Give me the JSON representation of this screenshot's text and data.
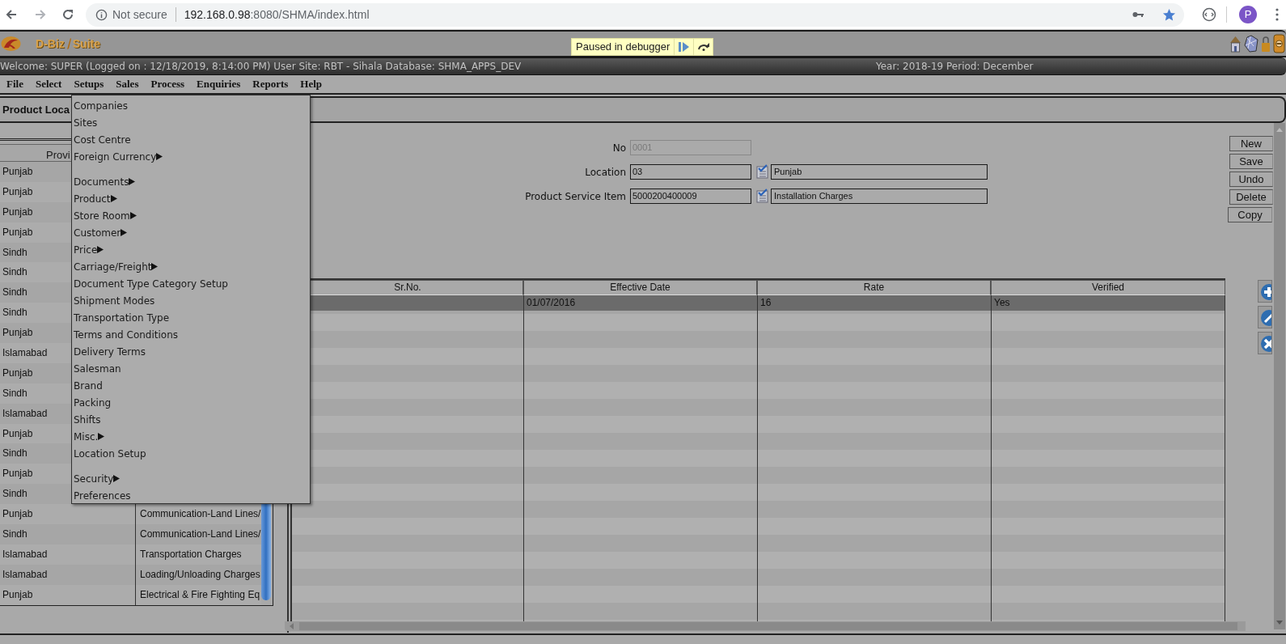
{
  "browser": {
    "security_label": "Not secure",
    "url_host": "192.168.0.98",
    "url_rest": ":8080/SHMA/index.html",
    "profile_initial": "P"
  },
  "app_header": {
    "logo_text_1": "D-Biz",
    "logo_text_2": "Suite"
  },
  "debugger_banner": {
    "label": "Paused in debugger"
  },
  "status_bar": {
    "welcome": "Welcome: SUPER (Logged on : 12/18/2019, 8:14:00 PM) User Site: RBT - Sihala Database: SHMA_APPS_DEV",
    "period": "Year: 2018-19 Period: December"
  },
  "menu_bar": [
    "File",
    "Select",
    "Setups",
    "Sales",
    "Process",
    "Enquiries",
    "Reports",
    "Help"
  ],
  "open_menu": {
    "groups": [
      [
        {
          "label": "Companies",
          "submenu": false
        },
        {
          "label": "Sites",
          "submenu": false
        },
        {
          "label": "Cost Centre",
          "submenu": false
        },
        {
          "label": "Foreign Currency",
          "submenu": true
        }
      ],
      [
        {
          "label": "Documents",
          "submenu": true
        },
        {
          "label": "Product",
          "submenu": true
        },
        {
          "label": "Store Room",
          "submenu": true
        },
        {
          "label": "Customer",
          "submenu": true
        },
        {
          "label": "Price",
          "submenu": true
        },
        {
          "label": "Carriage/Freight",
          "submenu": true
        },
        {
          "label": "Document Type Category Setup",
          "submenu": false
        },
        {
          "label": "Shipment Modes",
          "submenu": false
        },
        {
          "label": "Transportation Type",
          "submenu": false
        },
        {
          "label": "Terms and Conditions",
          "submenu": false
        },
        {
          "label": "Delivery Terms",
          "submenu": false
        },
        {
          "label": "Salesman",
          "submenu": false
        },
        {
          "label": "Brand",
          "submenu": false
        },
        {
          "label": "Packing",
          "submenu": false
        },
        {
          "label": "Shifts",
          "submenu": false
        },
        {
          "label": "Misc.",
          "submenu": true
        },
        {
          "label": "Location Setup",
          "submenu": false
        }
      ],
      [
        {
          "label": "Security",
          "submenu": true
        },
        {
          "label": "Preferences",
          "submenu": false
        }
      ]
    ]
  },
  "page_title": "Product Loca",
  "left_table": {
    "column_1": "Provi",
    "rows": [
      {
        "province": "Punjab"
      },
      {
        "province": "Punjab"
      },
      {
        "province": "Punjab"
      },
      {
        "province": "Punjab"
      },
      {
        "province": "Sindh"
      },
      {
        "province": "Sindh"
      },
      {
        "province": "Sindh"
      },
      {
        "province": "Sindh"
      },
      {
        "province": "Punjab"
      },
      {
        "province": "Islamabad"
      },
      {
        "province": "Punjab"
      },
      {
        "province": "Sindh"
      },
      {
        "province": "Islamabad"
      },
      {
        "province": "Punjab"
      },
      {
        "province": "Sindh"
      },
      {
        "province": "Punjab"
      },
      {
        "province": "Sindh"
      },
      {
        "province": "Punjab",
        "item": "Communication-Land Lines/"
      },
      {
        "province": "Sindh",
        "item": "Communication-Land Lines/"
      },
      {
        "province": "Islamabad",
        "item": "Transportation Charges"
      },
      {
        "province": "Islamabad",
        "item": "Loading/Unloading Charges"
      },
      {
        "province": "Punjab",
        "item": "Electrical & Fire Fighting Eq"
      }
    ]
  },
  "form": {
    "fields": [
      {
        "label": "No",
        "value": "0001",
        "disabled": true
      },
      {
        "label": "Location",
        "value": "03",
        "lookup": "Punjab",
        "disabled": false
      },
      {
        "label": "Product Service Item",
        "value": "5000200400009",
        "lookup": "Installation Charges",
        "disabled": false
      }
    ]
  },
  "actions": [
    "New",
    "Save",
    "Undo",
    "Delete",
    "Copy"
  ],
  "grid": {
    "columns": [
      "Sr.No.",
      "Effective Date",
      "Rate",
      "Verified"
    ],
    "rows": [
      {
        "effective_date": "01/07/2016",
        "rate": "16",
        "verified": "Yes",
        "selected": true
      }
    ]
  }
}
